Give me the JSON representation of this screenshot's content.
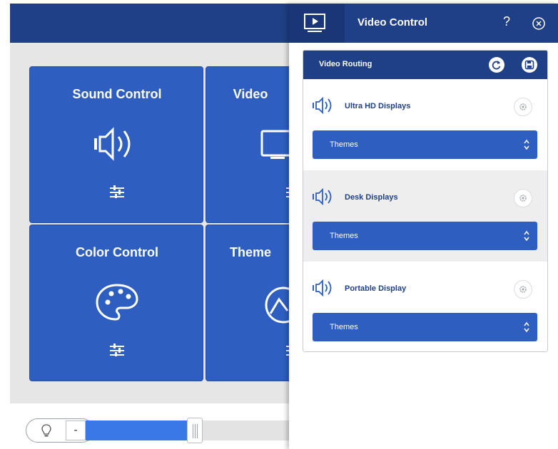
{
  "tiles": [
    {
      "title": "Sound Control",
      "icon": "speaker-icon"
    },
    {
      "title": "Video",
      "icon": "monitor-icon"
    },
    {
      "title": "Color Control",
      "icon": "palette-icon"
    },
    {
      "title": "Theme",
      "icon": "theme-icon"
    }
  ],
  "brightness": {
    "minus_label": "-",
    "level_fraction": 0.52
  },
  "panel": {
    "title": "Video Control",
    "help_label": "?",
    "card": {
      "title": "Video Routing",
      "sections": [
        {
          "label": "Ultra HD Displays",
          "select_value": "Themes"
        },
        {
          "label": "Desk Displays",
          "select_value": "Themes"
        },
        {
          "label": "Portable Display",
          "select_value": "Themes"
        }
      ]
    }
  },
  "colors": {
    "header": "#1f3f86",
    "tile": "#2e5fc0",
    "accent": "#3b78e7",
    "background": "#e6e6e6"
  }
}
